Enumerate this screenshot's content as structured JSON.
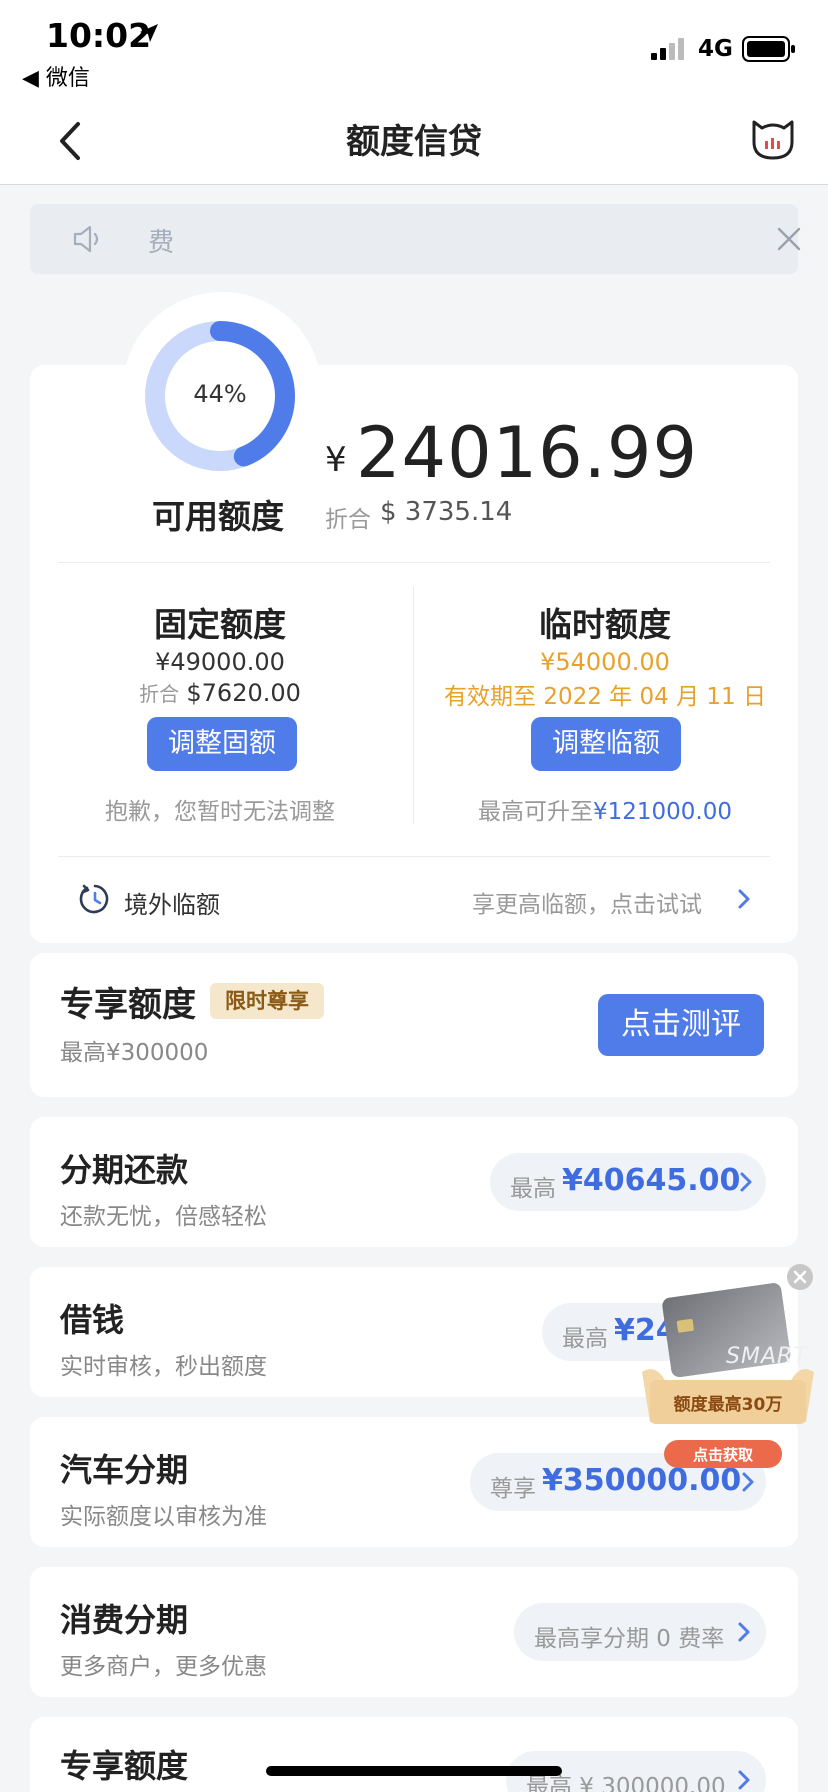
{
  "status": {
    "time": "10:02",
    "back_app": "◀ 微信",
    "network": "4G"
  },
  "nav": {
    "title": "额度信贷"
  },
  "notice": {
    "text": "费"
  },
  "credit": {
    "usage_percent_label": "44%",
    "usage_fraction": 0.44,
    "available_label": "可用额度",
    "currency_symbol": "¥",
    "available_amount": "24016.99",
    "fold_label": "折合",
    "fold_value": "$ 3735.14",
    "fixed": {
      "title": "固定额度",
      "amount": "¥49000.00",
      "fold_label": "折合",
      "fold_value": "$7620.00",
      "button": "调整固额",
      "note": "抱歉，您暂时无法调整"
    },
    "temp": {
      "title": "临时额度",
      "amount": "¥54000.00",
      "validity": "有效期至 2022 年 04 月 11 日",
      "button": "调整临额",
      "note_prefix": "最高可升至",
      "note_amount": "¥121000.00"
    },
    "overseas": {
      "label": "境外临额",
      "hint": "享更高临额，点击试试"
    }
  },
  "exclusive": {
    "title": "专享额度",
    "badge": "限时尊享",
    "sub": "最高¥300000",
    "button": "点击测评"
  },
  "products": [
    {
      "title": "分期还款",
      "sub": "还款无忧，倍感轻松",
      "prefix": "最高",
      "amount": "¥40645.00"
    },
    {
      "title": "借钱",
      "sub": "实时审核，秒出额度",
      "prefix": "最高",
      "amount": "¥24"
    },
    {
      "title": "汽车分期",
      "sub": "实际额度以审核为准",
      "prefix": "尊享",
      "amount": "¥350000.00"
    },
    {
      "title": "消费分期",
      "sub": "更多商户，更多优惠",
      "prefix": "最高享分期 0 费率",
      "amount": ""
    },
    {
      "title": "专享额度",
      "sub": "",
      "prefix": "最高 ¥ 300000.00",
      "amount": ""
    }
  ],
  "promo": {
    "card_text": "SMART",
    "line1": "额度最高30万",
    "button": "点击获取"
  },
  "colors": {
    "accent": "#4f7ce8",
    "orange": "#e8a12b",
    "donut_track": "#c9d8fb"
  }
}
